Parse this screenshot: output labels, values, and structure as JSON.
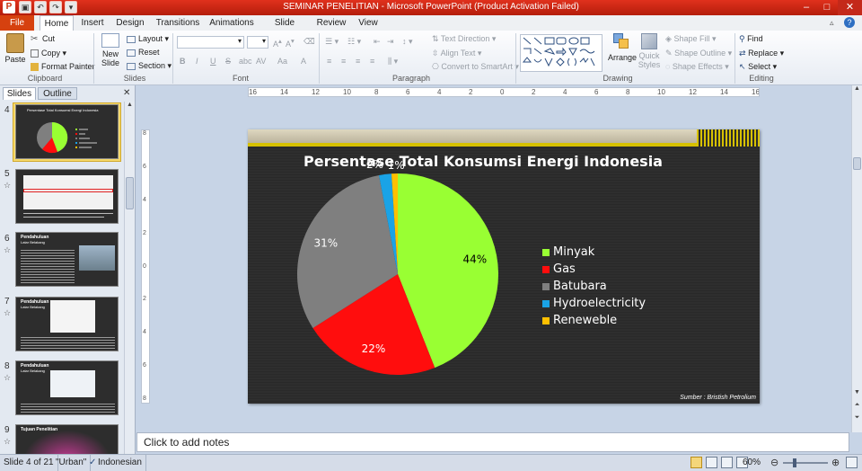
{
  "window": {
    "title": "SEMINAR PENELITIAN  -  Microsoft PowerPoint (Product Activation Failed)"
  },
  "tabs": [
    "File",
    "Home",
    "Insert",
    "Design",
    "Transitions",
    "Animations",
    "Slide Show",
    "Review",
    "View"
  ],
  "ribbon": {
    "clipboard": {
      "paste": "Paste",
      "cut": "Cut",
      "copy": "Copy",
      "format_painter": "Format Painter",
      "label": "Clipboard"
    },
    "slides": {
      "new_slide_1": "New",
      "new_slide_2": "Slide",
      "layout": "Layout",
      "reset": "Reset",
      "section": "Section",
      "label": "Slides"
    },
    "font": {
      "label": "Font",
      "bold": "B",
      "italic": "I",
      "underline": "U",
      "strike": "S",
      "shadow": "abc",
      "spacing": "AV",
      "case": "Aa",
      "color": "A"
    },
    "paragraph": {
      "text_direction": "Text Direction",
      "align_text": "Align Text",
      "convert_smartart": "Convert to SmartArt",
      "label": "Paragraph"
    },
    "drawing": {
      "arrange": "Arrange",
      "quick_styles_1": "Quick",
      "quick_styles_2": "Styles",
      "shape_fill": "Shape Fill",
      "shape_outline": "Shape Outline",
      "shape_effects": "Shape Effects",
      "label": "Drawing"
    },
    "editing": {
      "find": "Find",
      "replace": "Replace",
      "select": "Select",
      "label": "Editing"
    }
  },
  "panel_tabs": {
    "slides": "Slides",
    "outline": "Outline"
  },
  "thumbnails": [
    {
      "num": "4",
      "title": "Persentase Total Konsumsi Energi Indonesia"
    },
    {
      "num": "5",
      "title": ""
    },
    {
      "num": "6",
      "title": "Pendahuluan",
      "subtitle": "Latar Belakang"
    },
    {
      "num": "7",
      "title": "Pendahuluan",
      "subtitle": "Latar Belakang"
    },
    {
      "num": "8",
      "title": "Pendahuluan",
      "subtitle": "Latar Belakang"
    },
    {
      "num": "9",
      "title": "Tujuan Penelitian"
    }
  ],
  "ruler": {
    "h_ticks": [
      "16",
      "14",
      "12",
      "10",
      "8",
      "6",
      "4",
      "2",
      "0",
      "2",
      "4",
      "6",
      "8",
      "10",
      "12",
      "14",
      "16"
    ],
    "v_ticks": [
      "8",
      "6",
      "4",
      "2",
      "0",
      "2",
      "4",
      "6",
      "8"
    ]
  },
  "slide": {
    "source": "Sumber : Bristish Petrolium"
  },
  "chart_data": {
    "type": "pie",
    "title": "Persentase Total Konsumsi Energi Indonesia",
    "categories": [
      "Minyak",
      "Gas",
      "Batubara",
      "Hydroelectricity",
      "Renewable"
    ],
    "legend_labels": [
      "Minyak",
      "Gas",
      "Batubara",
      "Hydroelectricity",
      "Reneweble"
    ],
    "values": [
      44,
      22,
      31,
      2,
      1
    ],
    "data_labels": [
      "44%",
      "22%",
      "31%",
      "2%",
      "1%"
    ],
    "colors": [
      "#99ff33",
      "#ff0d0d",
      "#7f7f7f",
      "#1aa3e6",
      "#ffc000"
    ],
    "legend_position": "right"
  },
  "notes": {
    "placeholder": "Click to add notes"
  },
  "status": {
    "slide": "Slide 4 of 21",
    "theme": "\"Urban\"",
    "language": "Indonesian",
    "zoom": "60%"
  }
}
